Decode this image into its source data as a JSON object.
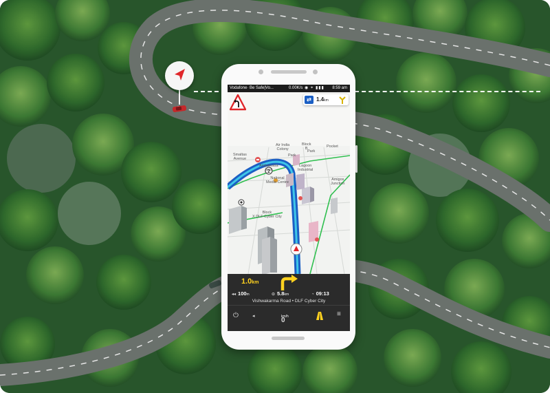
{
  "phone": {
    "status_bar": {
      "carrier": "Vodafone· Be Safe|Vo...",
      "speed": "0.00K/s",
      "icons": "◉ ⌖ ▮▮▮",
      "time": "8:59 am"
    },
    "lane_info": {
      "highway_icon": "highway-icon",
      "distance": "1.4",
      "distance_unit": "km",
      "fork_icon": "fork-arrow-icon"
    },
    "turn_sign_icon": "turn-left-warning-icon",
    "map_labels": {
      "air_india_colony": "Air India\nColony",
      "block_b": "Block\nB",
      "pocket": "Pocket",
      "smaltas_avenue": "Smaltas\nAvenue",
      "park1": "Park",
      "park2": "Park",
      "ambawatta": "Ambawatta\nIeia",
      "lagoon": "Lagoon\nIndustrial",
      "national_media": "National\nMedia Centre",
      "amigos": "Amigos\nJunction",
      "block_dlf": "Block\nX DLF Cyber City",
      "waypoint_label": "2"
    },
    "nav_panel": {
      "next_turn_distance": "1.0",
      "next_turn_unit": "km",
      "remaining_turns_distance": "100",
      "remaining_turns_unit": "m",
      "total_distance": "5.8",
      "total_distance_unit": "km",
      "eta": "09:13",
      "road_name": "Vishwakarma Road • DLF Cyber City",
      "speed": "0",
      "speed_unit": "km/h"
    },
    "bottom_bar_icons": [
      "power-icon",
      "volume-icon",
      "lane-assist-icon",
      "menu-icon"
    ]
  },
  "colors": {
    "accent_yellow": "#ffd21f",
    "route_blue": "#1b5fc4",
    "route_green": "#2fbf4f",
    "panel_dark": "#2b2b2b",
    "forest_green": "#2d5e2f",
    "road_gray": "#5f6662",
    "pin_red": "#e0262a"
  }
}
